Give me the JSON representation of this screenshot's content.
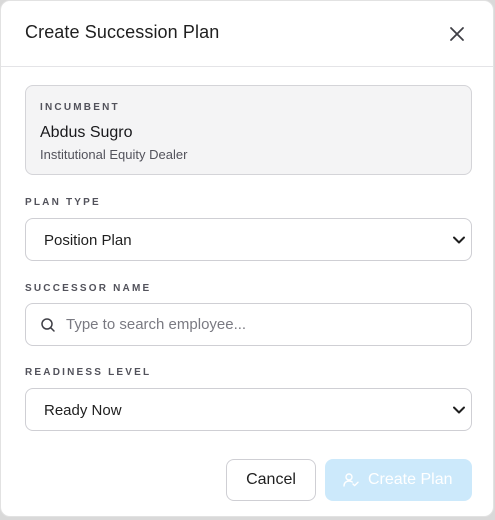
{
  "dialog": {
    "title": "Create Succession Plan",
    "close_icon": "close-icon"
  },
  "incumbent": {
    "label": "INCUMBENT",
    "name": "Abdus Sugro",
    "role": "Institutional Equity Dealer"
  },
  "plan_type": {
    "label": "PLAN TYPE",
    "value": "Position Plan",
    "icon": "chevron-down-icon"
  },
  "successor": {
    "label": "SUCCESSOR NAME",
    "placeholder": "Type to search employee...",
    "value": "",
    "icon": "search-icon"
  },
  "readiness": {
    "label": "READINESS LEVEL",
    "value": "Ready Now",
    "icon": "chevron-down-icon"
  },
  "actions": {
    "cancel_label": "Cancel",
    "create_label": "Create Plan",
    "create_icon": "user-check-icon",
    "create_enabled": false
  },
  "colors": {
    "primary_disabled": "#cce9fb",
    "border": "#cfcfd4",
    "text": "#1f1f1f",
    "muted_text": "#52525b"
  }
}
